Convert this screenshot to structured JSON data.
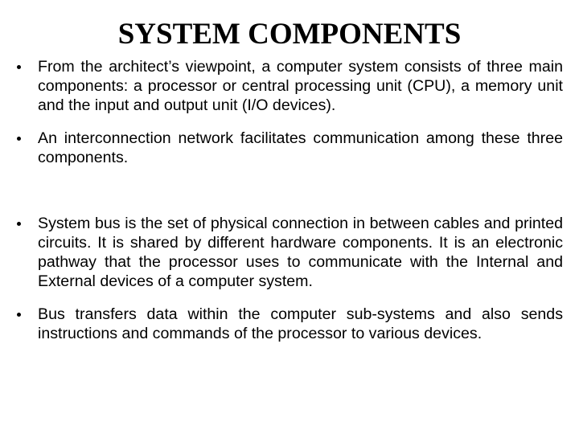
{
  "slide": {
    "title": "SYSTEM COMPONENTS",
    "bullets": [
      {
        "icon": "bullet-dot",
        "text": "From the architect’s viewpoint, a computer system consists of three main components: a processor or central processing unit (CPU), a memory unit and the input and output unit (I/O devices)."
      },
      {
        "icon": "bullet-dot",
        "text": "An interconnection network facilitates communication among these three components."
      },
      {
        "icon": "bullet-dot",
        "text": "System bus is the set of physical connection in between cables and printed circuits. It is shared by different hardware components. It is an electronic pathway that the processor uses to communicate with the Internal and External devices of a computer system."
      },
      {
        "icon": "bullet-dot",
        "text": "Bus transfers data within the computer sub-systems and also sends instructions and commands of the processor to various devices."
      }
    ]
  }
}
